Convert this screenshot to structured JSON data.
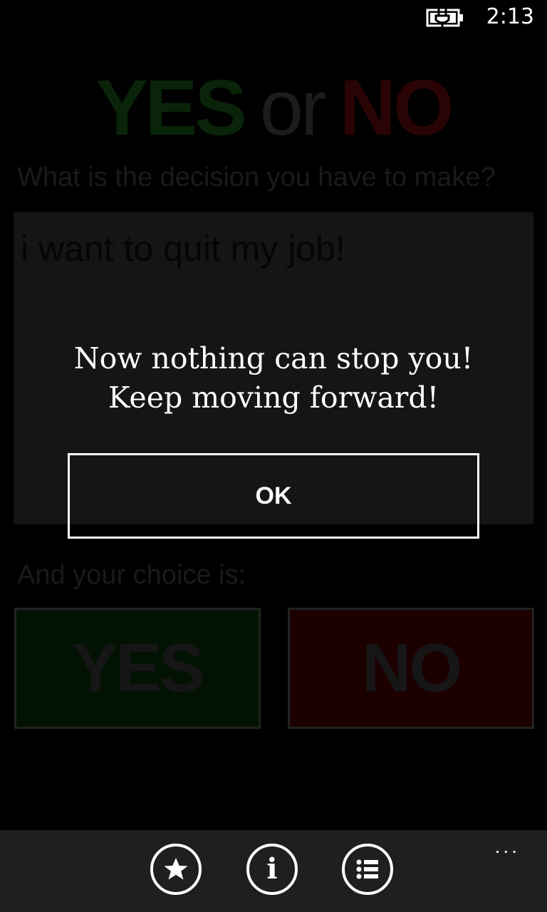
{
  "status_bar": {
    "time": "2:13",
    "battery_icon": "battery-charging-icon"
  },
  "header": {
    "title_yes": "YES",
    "title_or": "or",
    "title_no": "NO"
  },
  "form": {
    "question_label": "What is the decision you have to make?",
    "decision_value": "i want to quit my job!",
    "choice_label": "And your choice is:",
    "yes_button": "YES",
    "no_button": "NO"
  },
  "dialog": {
    "message_line1": "Now nothing can stop you!",
    "message_line2": "Keep moving forward!",
    "ok_label": "OK"
  },
  "app_bar": {
    "buttons": [
      {
        "icon": "star-icon"
      },
      {
        "icon": "info-icon"
      },
      {
        "icon": "list-icon"
      }
    ],
    "more_label": "..."
  },
  "colors": {
    "background": "#000000",
    "dialog_text": "#ffffff",
    "app_bar": "#1f1f1f",
    "yes_green": "#092409",
    "no_red": "#2a0404"
  }
}
